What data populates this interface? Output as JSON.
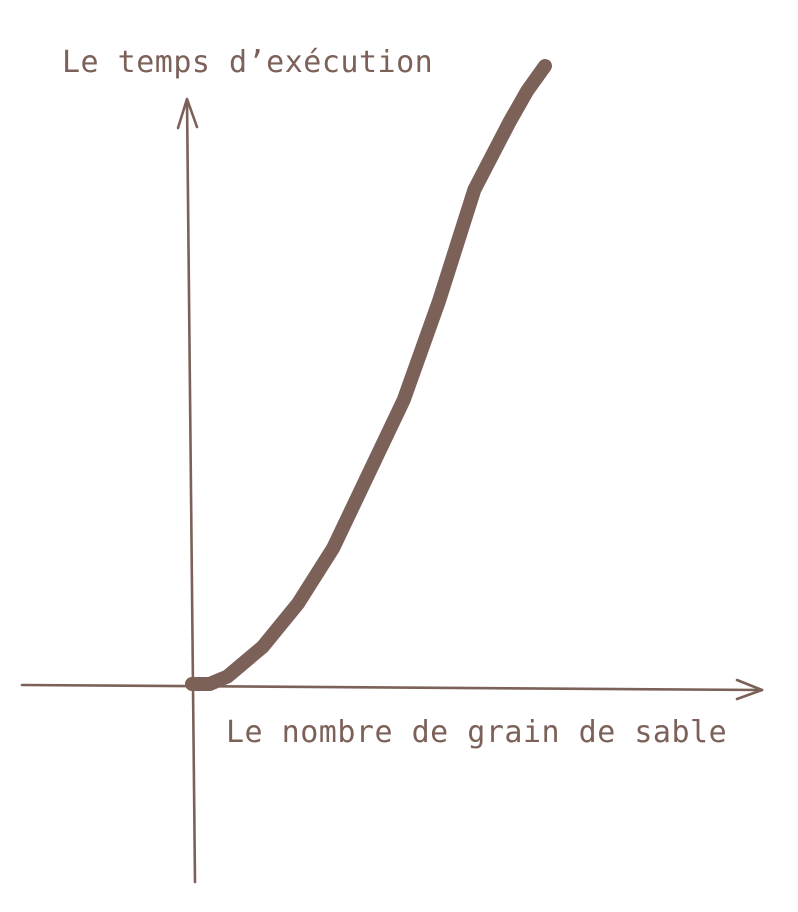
{
  "chart_data": {
    "type": "line",
    "xlabel": "Le nombre de grain de sable",
    "ylabel": "Le temps d’exécution",
    "grid": false,
    "legend": "none",
    "x": [
      0,
      0.05,
      0.1,
      0.2,
      0.3,
      0.4,
      0.5,
      0.6,
      0.7,
      0.8,
      0.9,
      0.95,
      1.0
    ],
    "y": [
      0,
      0,
      0.012,
      0.06,
      0.13,
      0.22,
      0.34,
      0.46,
      0.62,
      0.8,
      0.91,
      0.96,
      1.0
    ],
    "xlim": [
      0,
      1.15
    ],
    "ylim": [
      -0.32,
      1.0
    ]
  },
  "colors": {
    "ink": "#7c6159",
    "background": "#ffffff"
  }
}
